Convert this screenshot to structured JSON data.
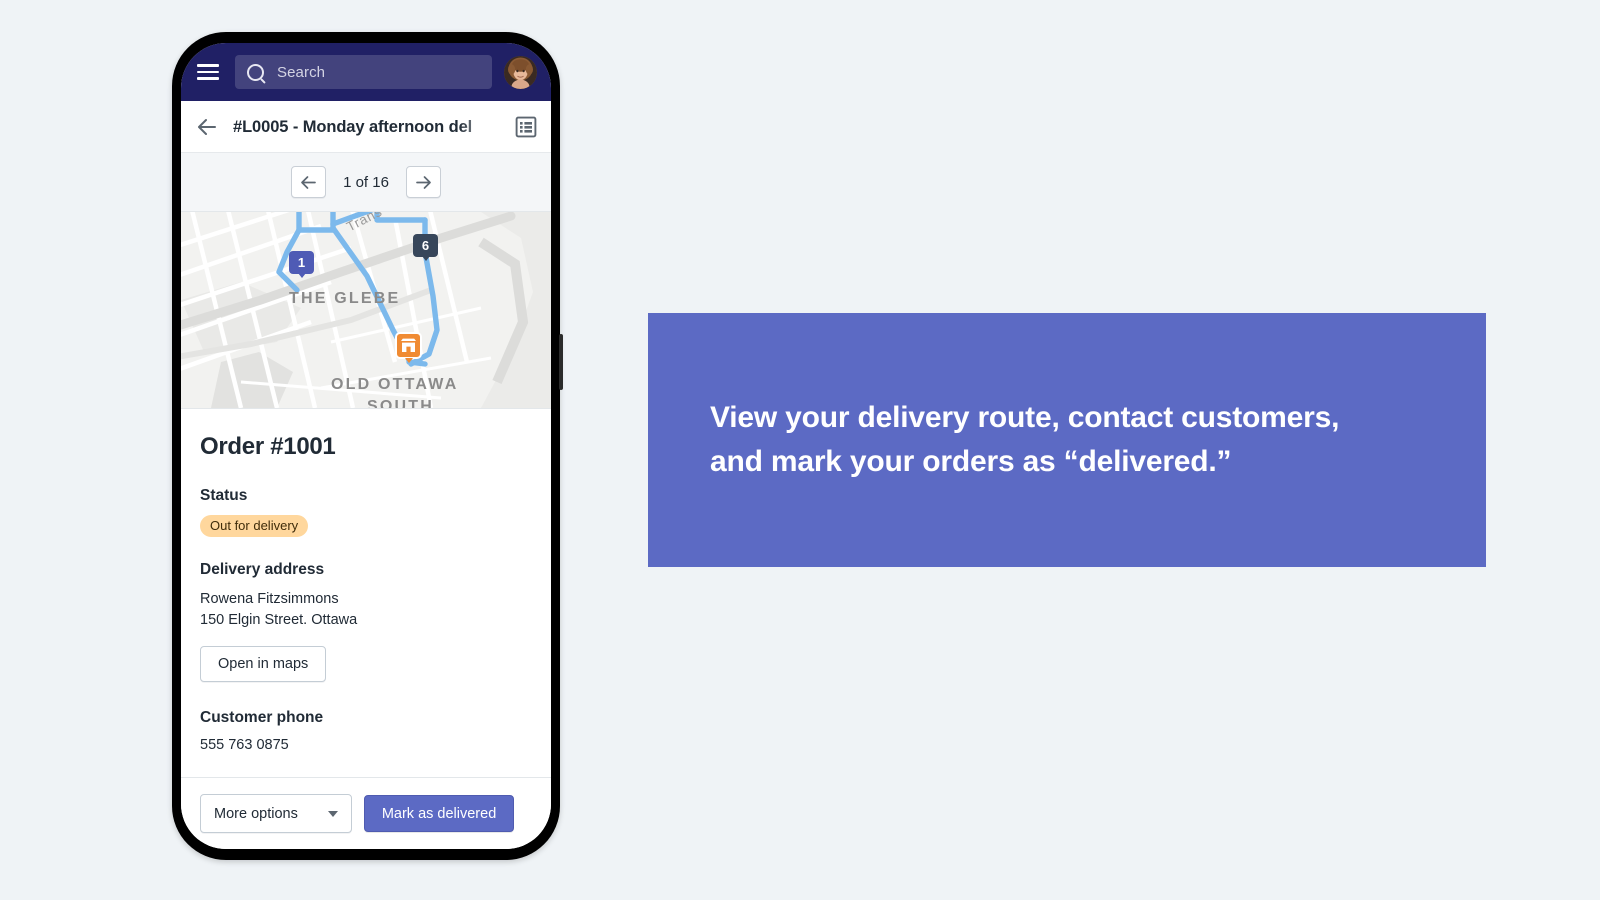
{
  "top_nav": {
    "menu_icon": "hamburger-menu-icon",
    "search_icon": "search-icon",
    "search_placeholder": "Search",
    "search_value": "",
    "avatar_icon": "user-avatar"
  },
  "title_bar": {
    "back_icon": "back-arrow-icon",
    "title": "#L0005 - Monday afternoon del",
    "list_view_icon": "list-view-icon"
  },
  "pagination": {
    "prev_icon": "arrow-left-icon",
    "next_icon": "arrow-right-icon",
    "count_label": "1 of 16"
  },
  "map": {
    "labels": {
      "neighbourhood": "THE GLEBE",
      "neighbourhood_2_line1": "OLD OTTAWA",
      "neighbourhood_2_line2": "SOUTH",
      "highway": "Trans-Canada"
    },
    "pins": [
      {
        "label": "1",
        "color": "#4f5bb5",
        "name": "map-pin-stop-1"
      },
      {
        "label": "6",
        "color": "#37465a",
        "name": "map-pin-stop-6"
      }
    ],
    "store_pin": "store-marker-icon",
    "route_color": "#7cb9ec"
  },
  "order": {
    "number": "Order #1001",
    "status_label": "Status",
    "status_value": "Out for delivery",
    "status_badge_color": "#ffd79d",
    "address_label": "Delivery address",
    "address_name": "Rowena Fitzsimmons",
    "address_street": "150 Elgin Street. Ottawa",
    "open_in_maps_label": "Open in maps",
    "phone_label": "Customer phone",
    "phone_value": "555 763 0875"
  },
  "actions": {
    "more_options_label": "More options",
    "more_options_icon": "chevron-down-icon",
    "mark_delivered_label": "Mark as delivered",
    "primary_color": "#5c6ac4"
  },
  "caption": {
    "line1": "View your delivery route, contact customers,",
    "line2": "and mark your orders as “delivered.”",
    "background_color": "#5c6ac4"
  }
}
